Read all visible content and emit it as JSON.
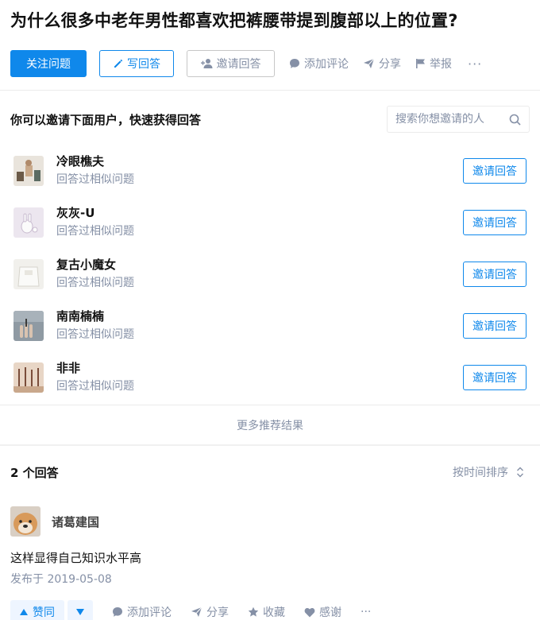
{
  "question": {
    "title": "为什么很多中老年男性都喜欢把裤腰带提到腹部以上的位置?"
  },
  "question_actions": {
    "follow": "关注问题",
    "write_answer": "写回答",
    "invite_answer": "邀请回答",
    "add_comment": "添加评论",
    "share": "分享",
    "report": "举报",
    "more": "···"
  },
  "invite": {
    "title": "你可以邀请下面用户，快速获得回答",
    "search_placeholder": "搜索你想邀请的人",
    "users": [
      {
        "name": "冷眼樵夫",
        "sub": "回答过相似问题",
        "button": "邀请回答"
      },
      {
        "name": "灰灰-U",
        "sub": "回答过相似问题",
        "button": "邀请回答"
      },
      {
        "name": "复古小魔女",
        "sub": "回答过相似问题",
        "button": "邀请回答"
      },
      {
        "name": "南南楠楠",
        "sub": "回答过相似问题",
        "button": "邀请回答"
      },
      {
        "name": "非非",
        "sub": "回答过相似问题",
        "button": "邀请回答"
      }
    ],
    "more_results": "更多推荐结果"
  },
  "answers": {
    "count_label": "2 个回答",
    "sort_label": "按时间排序",
    "items": [
      {
        "author": "诸葛建国",
        "text": "这样显得自己知识水平高",
        "date": "发布于 2019-05-08",
        "actions": {
          "upvote": "赞同",
          "comment": "添加评论",
          "share": "分享",
          "collect": "收藏",
          "thanks": "感谢",
          "more": "···"
        }
      }
    ]
  },
  "colors": {
    "accent": "#0f88eb",
    "muted": "#8590a6",
    "divider": "#ebebeb"
  }
}
